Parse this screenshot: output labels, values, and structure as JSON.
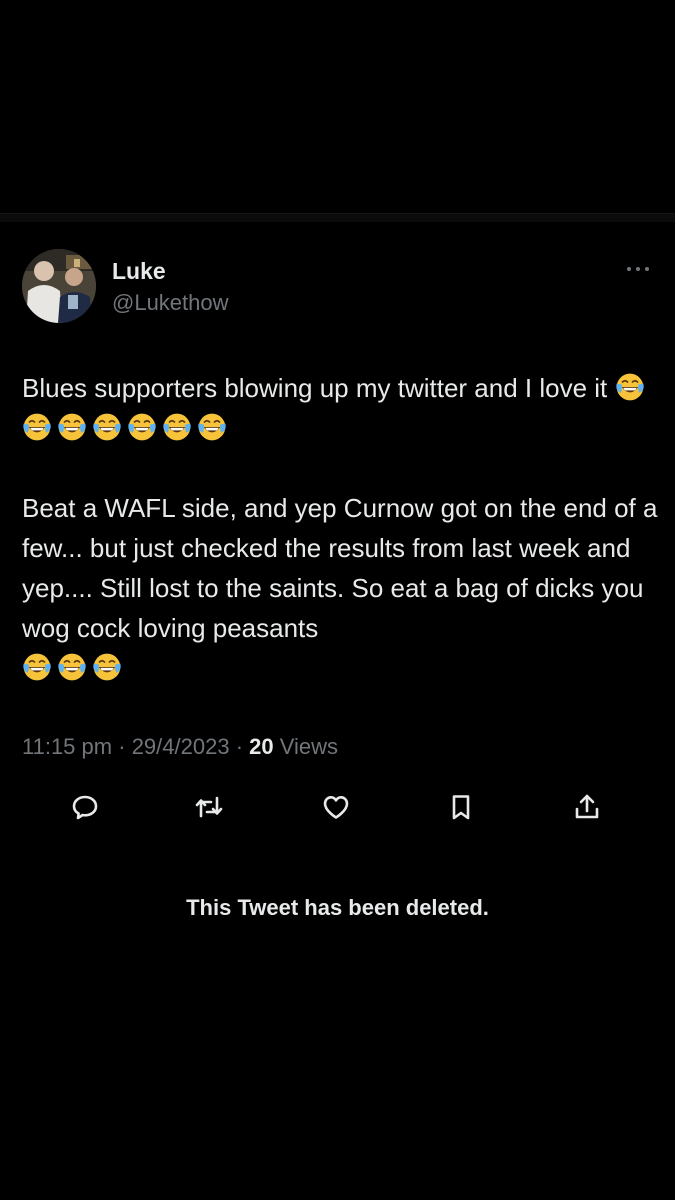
{
  "tweet": {
    "author": {
      "name": "Luke",
      "handle": "@Lukethow"
    },
    "text_line_1": "Blues supporters blowing up my twitter and I love it",
    "line_1_emoji_count": 7,
    "text_line_2": "Beat a WAFL side, and yep Curnow got on the end of a few... but just checked the results from last week and yep.... Still lost to the saints. So eat a bag of dicks you wog cock loving peasants",
    "line_2_emoji_count": 3,
    "emoji_name": "face-with-tears-of-joy-icon",
    "time": "11:15 pm",
    "separator": "·",
    "date": "29/4/2023",
    "views_count": "20",
    "views_label": "Views"
  },
  "actions": [
    "reply-icon",
    "retweet-icon",
    "like-icon",
    "bookmark-icon",
    "share-icon"
  ],
  "status_message": "This Tweet has been deleted.",
  "colors": {
    "background": "#000000",
    "primary_text": "#e7e9ea",
    "secondary_text": "#71767b"
  }
}
